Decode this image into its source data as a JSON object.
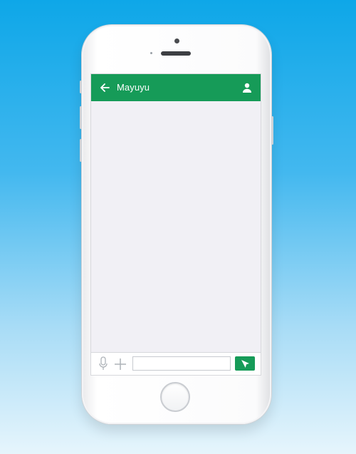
{
  "header": {
    "title": "Mayuyu",
    "back_icon": "arrow-left-icon",
    "profile_icon": "user-icon"
  },
  "composer": {
    "mic_icon": "microphone-icon",
    "add_icon": "plus-icon",
    "input_value": "",
    "input_placeholder": "",
    "send_icon": "send-icon"
  },
  "colors": {
    "accent": "#169b58",
    "screen_bg": "#f1f0f5",
    "background_top": "#0ea7e8",
    "background_bottom": "#e6f5fc"
  }
}
